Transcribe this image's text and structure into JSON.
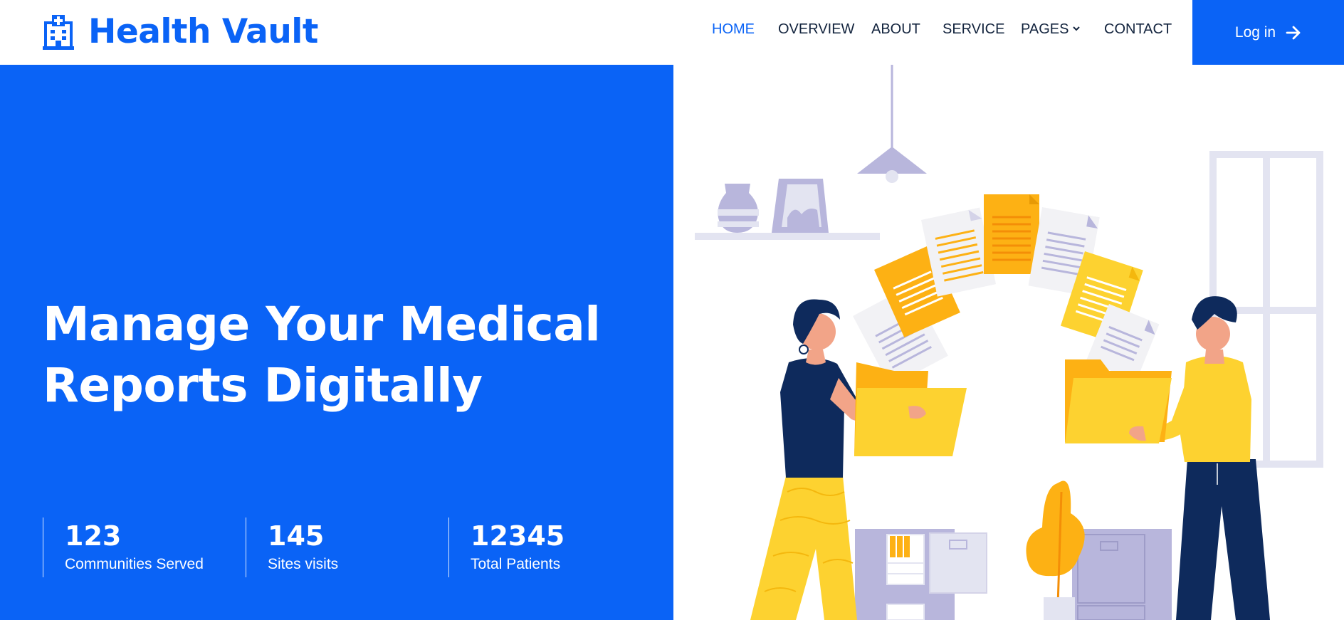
{
  "header": {
    "brand_name": "Health Vault",
    "brand_icon": "hospital-building-icon",
    "nav": [
      {
        "label": "HOME",
        "active": true
      },
      {
        "label": "OVERVIEW",
        "active": false
      },
      {
        "label": "ABOUT",
        "active": false
      },
      {
        "label": "SERVICE",
        "active": false
      },
      {
        "label": "PAGES",
        "active": false,
        "icon": "chevron-down-icon"
      },
      {
        "label": "CONTACT",
        "active": false
      }
    ],
    "login_label": "Log in",
    "login_icon": "arrow-right-icon"
  },
  "hero": {
    "title_line1": "Manage Your Medical",
    "title_line2": "Reports Digitally",
    "stats": [
      {
        "value": "123",
        "label": "Communities Served"
      },
      {
        "value": "145",
        "label": "Sites visits"
      },
      {
        "value": "12345",
        "label": "Total Patients"
      }
    ]
  },
  "colors": {
    "primary": "#0a63f6",
    "text_dark": "#12233d",
    "yellow": "#fdd230",
    "orange": "#fdb114",
    "lavender": "#b8b6dc",
    "navy": "#0e2a5c"
  }
}
